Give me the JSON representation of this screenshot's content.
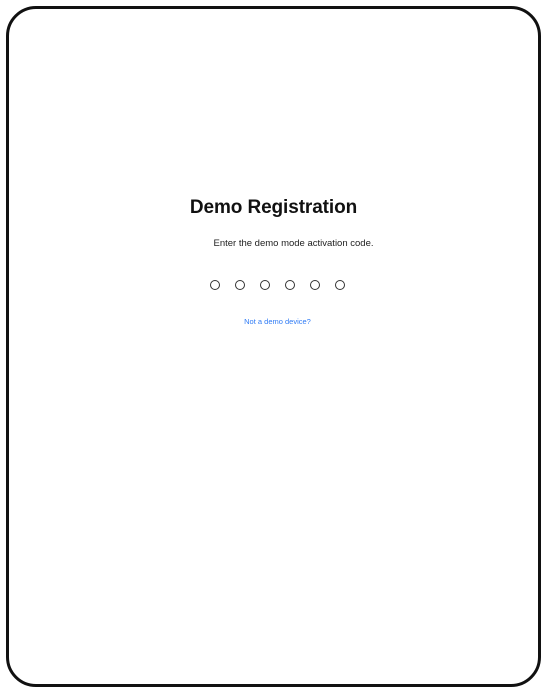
{
  "registration": {
    "title": "Demo Registration",
    "subtitle": "Enter the demo mode activation code.",
    "code_length": 6,
    "link_label": "Not a demo device?"
  },
  "colors": {
    "link": "#2f7bf5",
    "text": "#111111",
    "frame": "#111111"
  }
}
